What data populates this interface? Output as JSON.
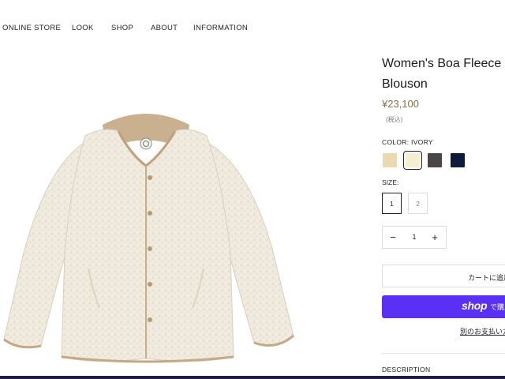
{
  "nav": {
    "items": [
      {
        "label": "ONLINE STORE"
      },
      {
        "label": "LOOK"
      },
      {
        "label": "SHOP"
      },
      {
        "label": "ABOUT"
      },
      {
        "label": "INFORMATION"
      }
    ]
  },
  "product": {
    "title": "Women's Boa Fleece Blouson",
    "price": "¥23,100",
    "tax_note": "(税込)"
  },
  "color": {
    "label": "COLOR: IVORY",
    "swatches": [
      {
        "name": "beige",
        "hex": "#ecd9b0"
      },
      {
        "name": "ivory",
        "hex": "#f6efcf"
      },
      {
        "name": "charcoal",
        "hex": "#4a4546"
      },
      {
        "name": "navy",
        "hex": "#0f1b3d"
      }
    ],
    "selected": "ivory"
  },
  "size": {
    "label": "SIZE:",
    "options": [
      "1",
      "2"
    ],
    "selected": "1"
  },
  "quantity": {
    "minus": "−",
    "value": "1",
    "plus": "+"
  },
  "actions": {
    "add_to_cart": "カートに追加",
    "shop_pay_logo": "shop",
    "shop_pay_suffix": "で購入",
    "other_payment": "別のお支払い方法"
  },
  "sections": {
    "description": "DESCRIPTION"
  },
  "colors": {
    "price": "#8a6d4a",
    "shop_pay": "#5a31f4",
    "bottom_bar": "#1e1a4a"
  }
}
